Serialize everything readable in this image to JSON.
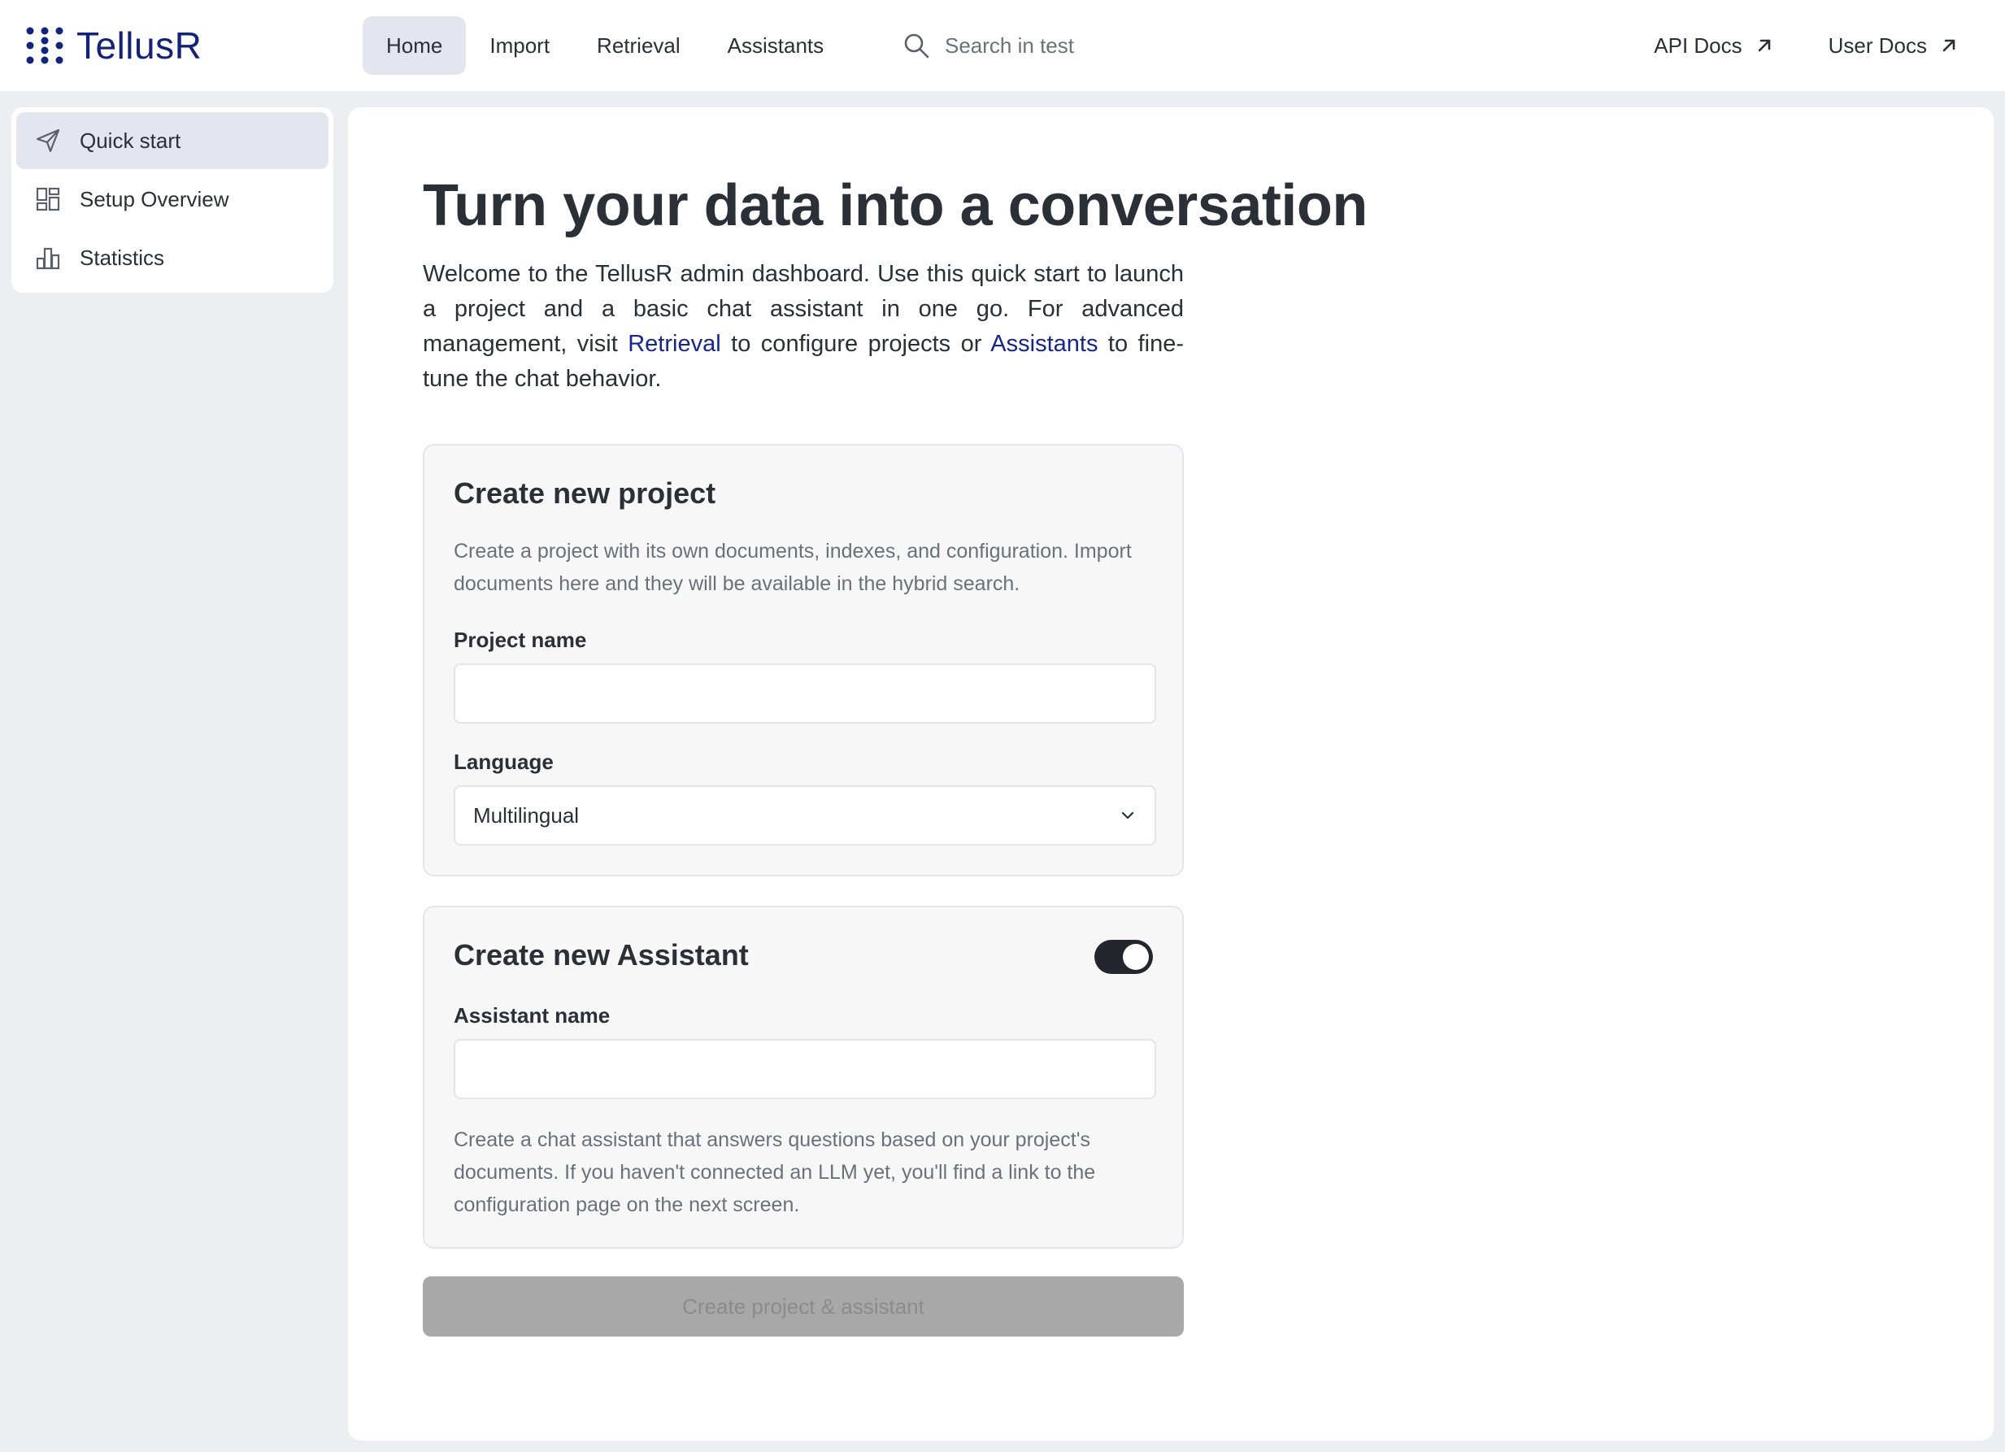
{
  "app": {
    "name": "TellusR"
  },
  "nav": {
    "items": [
      {
        "label": "Home",
        "active": true
      },
      {
        "label": "Import",
        "active": false
      },
      {
        "label": "Retrieval",
        "active": false
      },
      {
        "label": "Assistants",
        "active": false
      }
    ],
    "search_placeholder": "Search in test",
    "external_links": [
      {
        "label": "API Docs",
        "icon": "arrow-up-right-icon"
      },
      {
        "label": "User Docs",
        "icon": "arrow-up-right-icon"
      }
    ]
  },
  "sidebar": {
    "items": [
      {
        "label": "Quick start",
        "icon": "send-icon",
        "active": true
      },
      {
        "label": "Setup Overview",
        "icon": "dashboard-icon",
        "active": false
      },
      {
        "label": "Statistics",
        "icon": "bar-chart-icon",
        "active": false
      }
    ]
  },
  "main": {
    "headline": "Turn your data into a conversation",
    "intro": {
      "part1": "Welcome to the TellusR admin dashboard. Use this quick start to launch a project and a basic chat assistant in one go. For advanced management, visit ",
      "link1": "Retrieval",
      "part2": " to configure projects or ",
      "link2": "Assistants",
      "part3": " to fine-tune the chat behavior."
    },
    "project_card": {
      "title": "Create new project",
      "description": "Create a project with its own documents, indexes, and configuration. Import documents here and they will be available in the hybrid search.",
      "name_label": "Project name",
      "name_value": "",
      "language_label": "Language",
      "language_value": "Multilingual"
    },
    "assistant_card": {
      "title": "Create new Assistant",
      "toggle_on": true,
      "name_label": "Assistant name",
      "name_value": "",
      "description": "Create a chat assistant that answers questions based on your project's documents. If you haven't connected an LLM yet, you'll find a link to the configuration page on the next screen."
    },
    "submit_label": "Create project & assistant"
  },
  "colors": {
    "brand": "#12237e",
    "link": "#16249a",
    "active_bg": "#e3e6ef",
    "toggle_on": "#23262c",
    "button_disabled": "#a8a8a8"
  }
}
